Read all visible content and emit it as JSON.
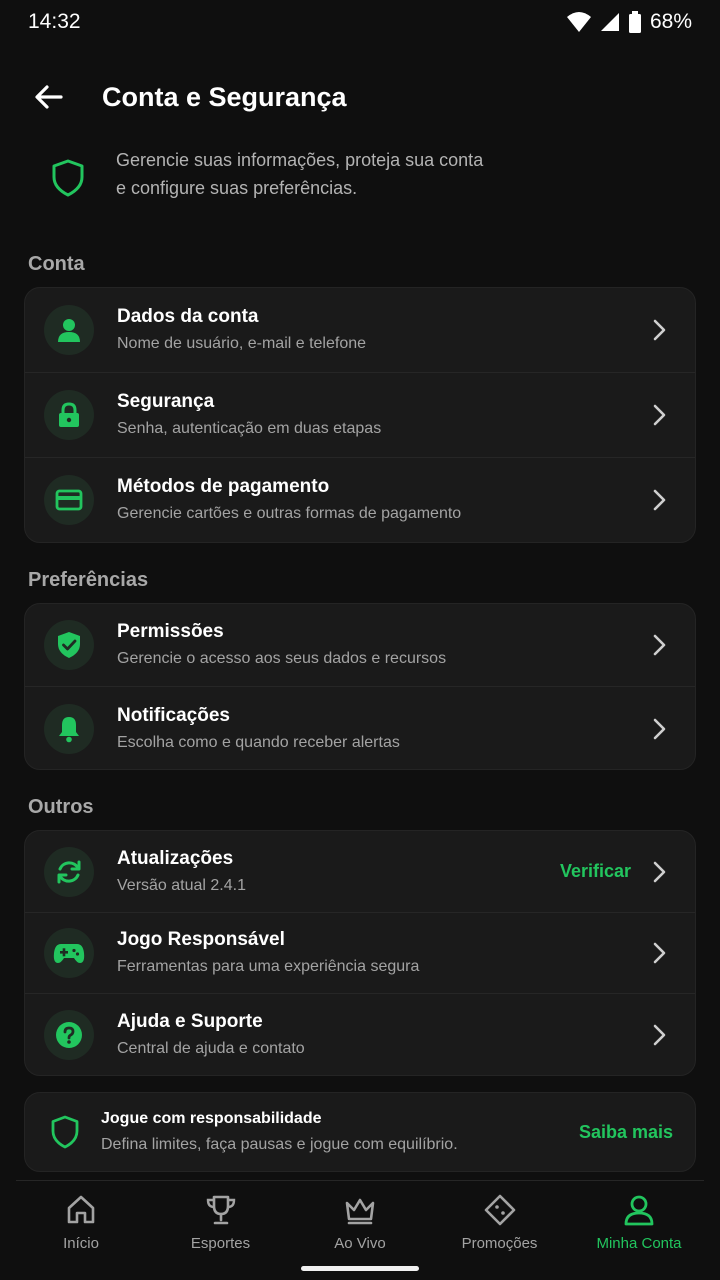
{
  "status": {
    "time": "14:32",
    "battery": "68%"
  },
  "header": {
    "title": "Conta e Segurança"
  },
  "intro": {
    "text_line1": "Gerencie suas informações, proteja sua conta",
    "text_line2": "e configure suas preferências."
  },
  "sections": {
    "conta": {
      "title": "Conta",
      "items": [
        {
          "title": "Dados da conta",
          "subtitle": "Nome de usuário, e-mail e telefone",
          "icon": "user-icon"
        },
        {
          "title": "Segurança",
          "subtitle": "Senha, autenticação em duas etapas",
          "icon": "lock-icon"
        },
        {
          "title": "Métodos de pagamento",
          "subtitle": "Gerencie cartões e outras formas de pagamento",
          "icon": "credit-card-icon"
        }
      ]
    },
    "preferencias": {
      "title": "Preferências",
      "items": [
        {
          "title": "Permissões",
          "subtitle": "Gerencie o acesso aos seus dados e recursos",
          "icon": "shield-check-icon"
        },
        {
          "title": "Notificações",
          "subtitle": "Escolha como e quando receber alertas",
          "icon": "bell-icon"
        }
      ]
    },
    "outros": {
      "title": "Outros",
      "items": [
        {
          "title": "Atualizações",
          "subtitle": "Versão atual 2.4.1",
          "icon": "refresh-icon",
          "action": "Verificar"
        },
        {
          "title": "Jogo Responsável",
          "subtitle": "Ferramentas para uma experiência segura",
          "icon": "gamepad-icon"
        },
        {
          "title": "Ajuda e Suporte",
          "subtitle": "Central de ajuda e contato",
          "icon": "help-icon"
        }
      ]
    }
  },
  "banner": {
    "title": "Jogue com responsabilidade",
    "subtitle": "Defina limites, faça pausas e jogue com equilíbrio.",
    "link": "Saiba mais"
  },
  "nav": [
    {
      "label": "Início",
      "icon": "home-icon"
    },
    {
      "label": "Esportes",
      "icon": "trophy-icon"
    },
    {
      "label": "Ao Vivo",
      "icon": "crown-icon"
    },
    {
      "label": "Promoções",
      "icon": "ticket-icon"
    },
    {
      "label": "Minha Conta",
      "icon": "user-outline-icon",
      "active": true
    }
  ],
  "colors": {
    "accent": "#22c55e",
    "background": "#0f0f0f",
    "card": "#1a1a1a"
  }
}
